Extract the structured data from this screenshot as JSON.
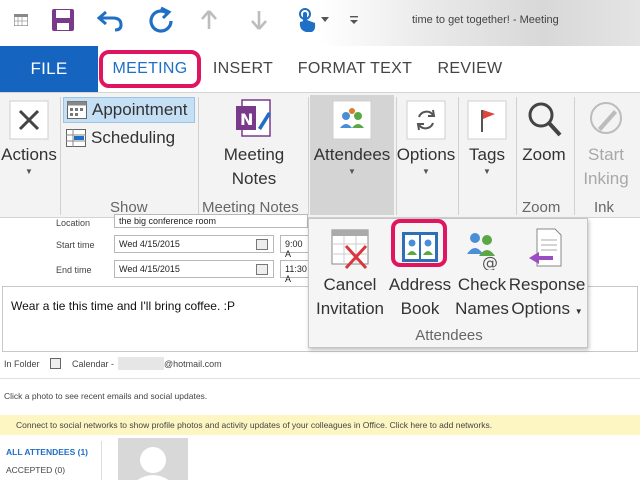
{
  "window": {
    "title": "time to get together! - Meeting"
  },
  "quick_access": {
    "save_icon": "save-icon",
    "undo_icon": "undo-icon",
    "redo_icon": "redo-icon",
    "up_icon": "arrow-up-icon",
    "down_icon": "arrow-down-icon",
    "touch_icon": "touch-mode-icon",
    "customize_icon": "customize-qat-icon"
  },
  "tabs": [
    {
      "label": "FILE"
    },
    {
      "label": "MEETING"
    },
    {
      "label": "INSERT"
    },
    {
      "label": "FORMAT TEXT"
    },
    {
      "label": "REVIEW"
    }
  ],
  "ribbon": {
    "actions": {
      "label": "Actions"
    },
    "show": {
      "appointment": "Appointment",
      "scheduling": "Scheduling",
      "group": "Show"
    },
    "meeting_notes": {
      "line1": "Meeting",
      "line2": "Notes",
      "group": "Meeting Notes"
    },
    "attendees": {
      "label": "Attendees"
    },
    "options": {
      "label": "Options"
    },
    "tags": {
      "label": "Tags"
    },
    "zoom": {
      "label": "Zoom",
      "group": "Zoom"
    },
    "ink": {
      "line1": "Start",
      "line2": "Inking",
      "group": "Ink"
    }
  },
  "form": {
    "location_label": "Location",
    "location_value": "the big conference room",
    "start_label": "Start time",
    "start_date": "Wed 4/15/2015",
    "start_time": "9:00 A",
    "end_label": "End time",
    "end_date": "Wed 4/15/2015",
    "end_time": "11:30 A",
    "body": "Wear a tie this time and I'll bring coffee. :P",
    "in_folder_label": "In Folder",
    "calendar_label": "Calendar -",
    "calendar_account": "@hotmail.com",
    "photo_hint": "Click a photo to see recent emails and social updates.",
    "social_bar": "Connect to social networks to show profile photos and activity updates of your colleagues in Office. Click here to add networks.",
    "all_attendees": "ALL ATTENDEES (1)",
    "accepted": "ACCEPTED (0)"
  },
  "attendees_dropdown": {
    "cancel": {
      "line1": "Cancel",
      "line2": "Invitation"
    },
    "address_book": {
      "line1": "Address",
      "line2": "Book"
    },
    "check_names": {
      "line1": "Check",
      "line2": "Names"
    },
    "response": {
      "line1": "Response",
      "line2": "Options"
    },
    "group": "Attendees"
  },
  "colors": {
    "file_tab": "#1565c0",
    "active_tab_text": "#1e6fc5",
    "highlight": "#e0155f"
  }
}
